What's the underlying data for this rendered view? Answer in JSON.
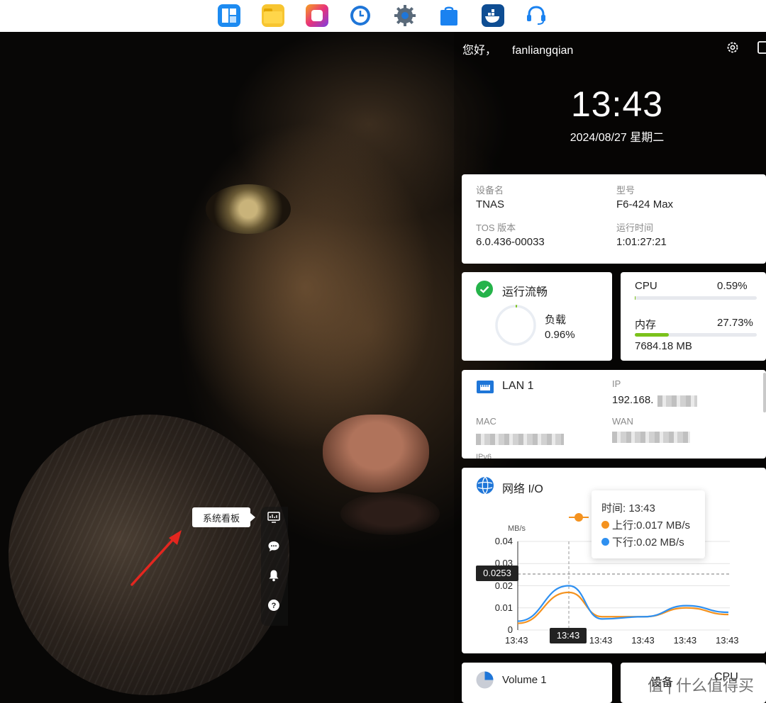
{
  "taskbar": {
    "apps": [
      {
        "name": "control-panel-icon",
        "color": "#1d8bf1"
      },
      {
        "name": "file-manager-icon",
        "color": "#f7c531"
      },
      {
        "name": "photos-icon",
        "color": "#e8337a"
      },
      {
        "name": "backup-icon",
        "color": "#1f76d8"
      },
      {
        "name": "settings-icon",
        "color": "#1f76d8"
      },
      {
        "name": "app-center-icon",
        "color": "#1a82f0"
      },
      {
        "name": "docker-icon",
        "color": "#0e4d93"
      },
      {
        "name": "support-icon",
        "color": "#1a82f0"
      }
    ]
  },
  "greeting": {
    "hello": "您好，",
    "user": "fanliangqian"
  },
  "clock": {
    "time": "13:43",
    "date": "2024/08/27 星期二"
  },
  "device": {
    "name_label": "设备名",
    "name_value": "TNAS",
    "model_label": "型号",
    "model_value": "F6-424 Max",
    "tos_label": "TOS 版本",
    "tos_value": "6.0.436-00033",
    "uptime_label": "运行时间",
    "uptime_value": "1:01:27:21"
  },
  "status": {
    "title": "运行流畅",
    "load_label": "负载",
    "load_value": "0.96%",
    "load_fraction": 0.0096,
    "accent": "#25b34a"
  },
  "resources": {
    "cpu_label": "CPU",
    "cpu_value": "0.59%",
    "cpu_fraction": 0.0059,
    "mem_label": "内存",
    "mem_value": "27.73%",
    "mem_fraction": 0.2773,
    "mem_used": "7684.18 MB"
  },
  "lan": {
    "title": "LAN 1",
    "ip_label": "IP",
    "ip_value": "192.168.",
    "mac_label": "MAC",
    "wan_label": "WAN",
    "ipv6_label": "IPv6"
  },
  "netio": {
    "title": "网络 I/O",
    "tooltip": {
      "time": "时间: 13:43",
      "up": "上行:0.017 MB/s",
      "down": "下行:0.02 MB/s"
    },
    "crosshair_y": "0.0253",
    "crosshair_x": "13:43"
  },
  "chart_data": {
    "type": "line",
    "ylabel": "MB/s",
    "ylim": [
      0,
      0.04
    ],
    "yticks": [
      "0.04",
      "0.03",
      "0.02",
      "0.01",
      "0"
    ],
    "categories": [
      "13:43",
      "13:43",
      "13:43",
      "13:43",
      "13:43",
      "13:43"
    ],
    "series": [
      {
        "name": "上行",
        "color": "#f4921f",
        "values": [
          0.003,
          0.017,
          0.006,
          0.006,
          0.01,
          0.007
        ]
      },
      {
        "name": "下行",
        "color": "#2f90f0",
        "values": [
          0.004,
          0.02,
          0.005,
          0.006,
          0.011,
          0.008
        ]
      }
    ]
  },
  "volume": {
    "title": "Volume 1"
  },
  "bottom_right": {
    "text": "设备",
    "cpu": "CPU"
  },
  "magnifier": {
    "tooltip": "系统看板"
  },
  "watermark": "值 | 什么值得买"
}
